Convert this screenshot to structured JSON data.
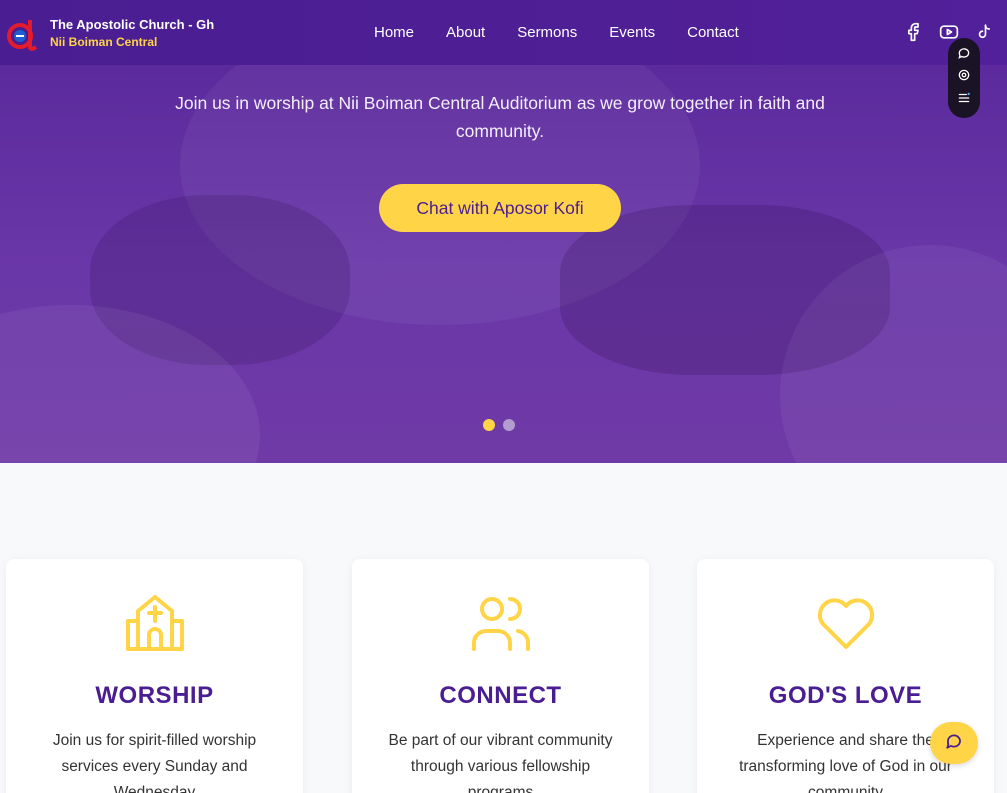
{
  "header": {
    "brand_title": "The Apostolic Church - Gh",
    "brand_subtitle": "Nii Boiman Central",
    "nav": [
      "Home",
      "About",
      "Sermons",
      "Events",
      "Contact"
    ],
    "socials": [
      "facebook-icon",
      "youtube-icon",
      "tiktok-icon"
    ]
  },
  "hero": {
    "text": "Join us in worship at Nii Boiman Central Auditorium as we grow together in faith and community.",
    "cta_label": "Chat with Aposor Kofi",
    "slides": 2,
    "active_slide": 1
  },
  "cards": [
    {
      "icon": "church-icon",
      "title": "WORSHIP",
      "text": "Join us for spirit-filled worship services every Sunday and Wednesday"
    },
    {
      "icon": "users-icon",
      "title": "CONNECT",
      "text": "Be part of our vibrant community through various fellowship programs"
    },
    {
      "icon": "heart-icon",
      "title": "GOD'S LOVE",
      "text": "Experience and share the transforming love of God in our community"
    }
  ],
  "colors": {
    "primary": "#4a1e92",
    "accent": "#ffd447",
    "hero_overlay": "#6a37a8"
  }
}
